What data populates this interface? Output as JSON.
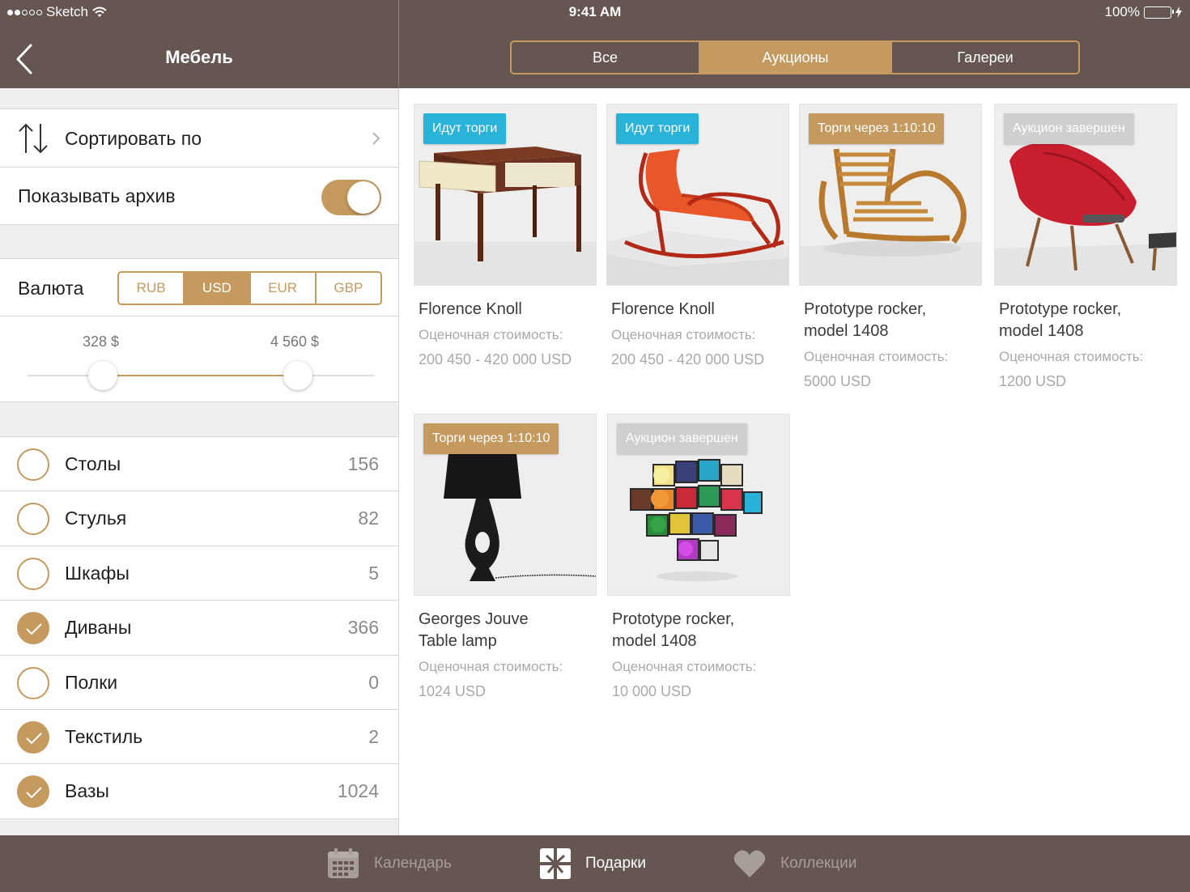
{
  "status_bar": {
    "carrier": "Sketch",
    "time": "9:41 AM",
    "battery": "100%"
  },
  "nav": {
    "title": "Мебель"
  },
  "segments": [
    {
      "label": "Все",
      "active": false
    },
    {
      "label": "Аукционы",
      "active": true
    },
    {
      "label": "Галереи",
      "active": false
    }
  ],
  "sidebar": {
    "sort_label": "Сортировать по",
    "archive_label": "Показывать архив",
    "archive_on": true,
    "currency_label": "Валюта",
    "currencies": [
      {
        "label": "RUB",
        "active": false
      },
      {
        "label": "USD",
        "active": true
      },
      {
        "label": "EUR",
        "active": false
      },
      {
        "label": "GBP",
        "active": false
      }
    ],
    "price_min": "328 $",
    "price_max": "4 560 $",
    "categories": [
      {
        "name": "Столы",
        "count": "156",
        "checked": false
      },
      {
        "name": "Стулья",
        "count": "82",
        "checked": false
      },
      {
        "name": "Шкафы",
        "count": "5",
        "checked": false
      },
      {
        "name": "Диваны",
        "count": "366",
        "checked": true
      },
      {
        "name": "Полки",
        "count": "0",
        "checked": false
      },
      {
        "name": "Текстиль",
        "count": "2",
        "checked": true
      },
      {
        "name": "Вазы",
        "count": "1024",
        "checked": true
      }
    ]
  },
  "items": [
    {
      "badge": "Идут торги",
      "badge_type": "live",
      "title_lines": [
        "Florence Knoll"
      ],
      "estimate_label": "Оценочная стоимость:",
      "price": "200 450 - 420 000 USD"
    },
    {
      "badge": "Идут торги",
      "badge_type": "live",
      "title_lines": [
        "Florence Knoll"
      ],
      "estimate_label": "Оценочная стоимость:",
      "price": "200 450 - 420 000 USD"
    },
    {
      "badge": "Торги через 1:10:10",
      "badge_type": "soon",
      "title_lines": [
        "Prototype rocker,",
        "model 1408"
      ],
      "estimate_label": "Оценочная стоимость:",
      "price": "5000 USD"
    },
    {
      "badge": "Аукцион завершен",
      "badge_type": "done",
      "title_lines": [
        "Prototype rocker,",
        "model 1408"
      ],
      "estimate_label": "Оценочная стоимость:",
      "price": "1200 USD"
    },
    {
      "badge": "Торги через 1:10:10",
      "badge_type": "soon",
      "title_lines": [
        "Georges Jouve",
        "Table lamp"
      ],
      "estimate_label": "Оценочная стоимость:",
      "price": "1024 USD"
    },
    {
      "badge": "Аукцион завершен",
      "badge_type": "done",
      "title_lines": [
        "Prototype rocker,",
        "model 1408"
      ],
      "estimate_label": "Оценочная стоимость:",
      "price": "10 000 USD"
    }
  ],
  "tabbar": [
    {
      "label": "Календарь",
      "icon": "calendar-icon",
      "active": false
    },
    {
      "label": "Подарки",
      "icon": "gift-icon",
      "active": true
    },
    {
      "label": "Коллекции",
      "icon": "heart-icon",
      "active": false
    }
  ],
  "colors": {
    "bar": "#655651",
    "accent": "#c49a5f",
    "live": "#2ab3d9",
    "done": "#cfcfcf"
  }
}
